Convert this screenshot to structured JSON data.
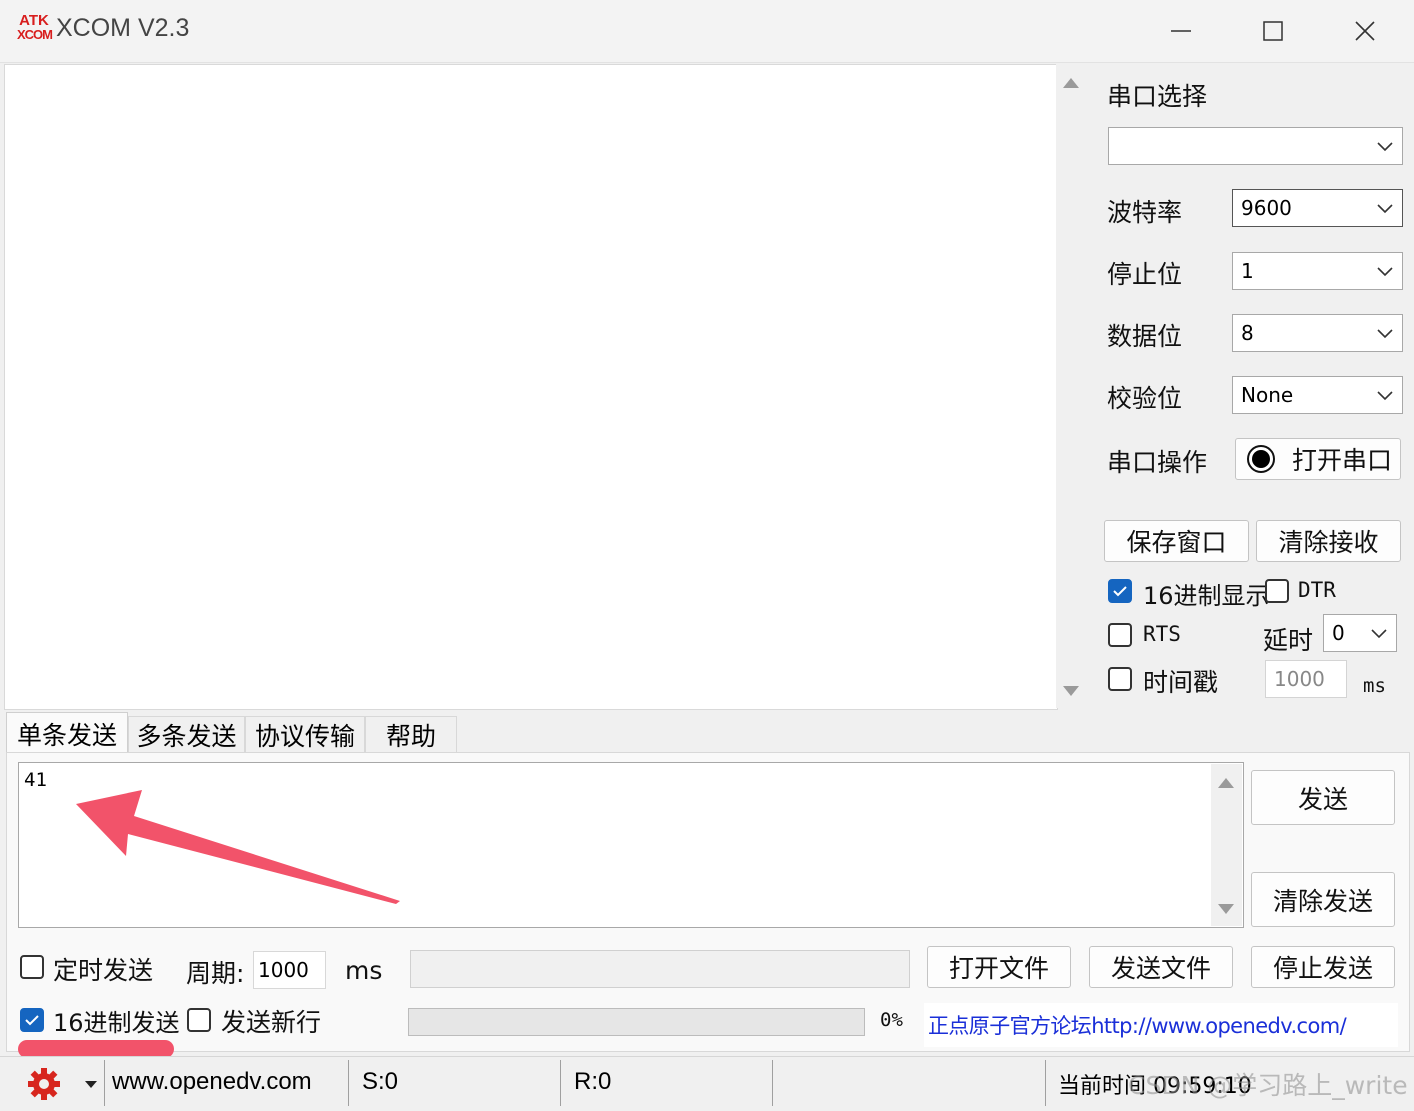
{
  "window": {
    "logo_top": "ATK",
    "logo_bottom": "XCOM",
    "title": "XCOM V2.3"
  },
  "serial": {
    "port_label": "串口选择",
    "port_value": "",
    "baud_label": "波特率",
    "baud_value": "9600",
    "stop_label": "停止位",
    "stop_value": "1",
    "data_label": "数据位",
    "data_value": "8",
    "parity_label": "校验位",
    "parity_value": "None",
    "op_label": "串口操作",
    "open_label": "打开串口"
  },
  "recv_controls": {
    "save_label": "保存窗口",
    "clear_label": "清除接收",
    "hex_display_label": "16进制显示",
    "hex_display_checked": true,
    "dtr_label": "DTR",
    "rts_label": "RTS",
    "delay_label": "延时",
    "delay_value": "0",
    "timestamp_label": "时间戳",
    "timestamp_value": "1000",
    "timestamp_unit": "ms"
  },
  "tabs": [
    {
      "label": "单条发送",
      "active": true
    },
    {
      "label": "多条发送",
      "active": false
    },
    {
      "label": "协议传输",
      "active": false
    },
    {
      "label": "帮助",
      "active": false
    }
  ],
  "send": {
    "text": "41",
    "send_label": "发送",
    "clear_send_label": "清除发送",
    "timed_label": "定时发送",
    "period_label": "周期:",
    "period_value": "1000",
    "period_unit": "ms",
    "open_file_label": "打开文件",
    "send_file_label": "发送文件",
    "stop_send_label": "停止发送",
    "hex_send_label": "16进制发送",
    "hex_send_checked": true,
    "newline_label": "发送新行",
    "progress_percent": "0%",
    "progress_value": 0,
    "forum_link": "正点原子官方论坛http://www.openedv.com/"
  },
  "status": {
    "url": "www.openedv.com",
    "sent": "S:0",
    "received": "R:0",
    "time": "当前时间 09:59:10",
    "watermark": "CSDN @学习路上_write"
  },
  "colors": {
    "accent": "#1565c0",
    "annotation": "#f2536a",
    "link": "#1a2fd8",
    "gear": "#d7261e"
  }
}
